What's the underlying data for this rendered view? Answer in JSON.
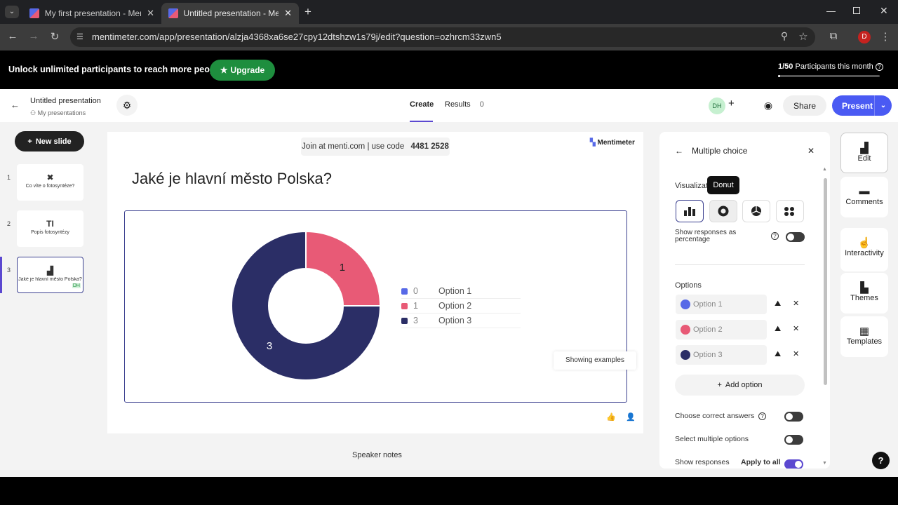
{
  "browser": {
    "tabs": [
      {
        "title": "My first presentation - Mentim"
      },
      {
        "title": "Untitled presentation - Mentim"
      }
    ],
    "url": "mentimeter.com/app/presentation/alzja4368xa6se27cpy12dtshzw1s79j/edit?question=ozhrcm33zwn5",
    "profile_initial": "D"
  },
  "banner": {
    "text": "Unlock unlimited participants to reach more people.",
    "upgrade_label": "Upgrade",
    "count": "1/50",
    "count_label": "Participants this month",
    "progress": 0.02
  },
  "header": {
    "title": "Untitled presentation",
    "breadcrumb": "My presentations",
    "tabs": [
      {
        "label": "Create"
      },
      {
        "label": "Results",
        "badge": "0"
      }
    ],
    "avatar": "DH",
    "share_label": "Share",
    "present_label": "Present"
  },
  "slides_panel": {
    "new_slide_label": "New slide",
    "slides": [
      {
        "num": "1",
        "title": "Co víte o fotosyntéze?"
      },
      {
        "num": "2",
        "title": "Popis fotosyntézy"
      },
      {
        "num": "3",
        "title": "Jaké je hlavní město Polska?",
        "badge": "DH"
      }
    ]
  },
  "slide": {
    "join_text": "Join at menti.com | use code",
    "join_code": "4481 2528",
    "brand": "Mentimeter",
    "question": "Jaké je hlavní město Polska?",
    "showing_examples": "Showing examples"
  },
  "chart_data": {
    "type": "pie",
    "donut": true,
    "categories": [
      "Option 1",
      "Option 2",
      "Option 3"
    ],
    "values": [
      0,
      1,
      3
    ],
    "colors": [
      "#5769e7",
      "#e85a76",
      "#2b2e66"
    ]
  },
  "speaker_notes": "Speaker notes",
  "editor": {
    "title": "Multiple choice",
    "visualization_label": "Visualizat",
    "tooltip": "Donut",
    "show_percentage_label": "Show responses as percentage",
    "options_label": "Options",
    "options": [
      {
        "label": "Option 1",
        "color": "#5769e7"
      },
      {
        "label": "Option 2",
        "color": "#e85a76"
      },
      {
        "label": "Option 3",
        "color": "#2b2e66"
      }
    ],
    "add_option_label": "Add option",
    "choose_correct_label": "Choose correct answers",
    "select_multiple_label": "Select multiple options",
    "show_responses_label": "Show responses",
    "apply_all_label": "Apply to all"
  },
  "right_nav": [
    {
      "label": "Edit"
    },
    {
      "label": "Comments"
    },
    {
      "label": "Interactivity"
    },
    {
      "label": "Themes"
    },
    {
      "label": "Templates"
    }
  ],
  "help_label": "?"
}
